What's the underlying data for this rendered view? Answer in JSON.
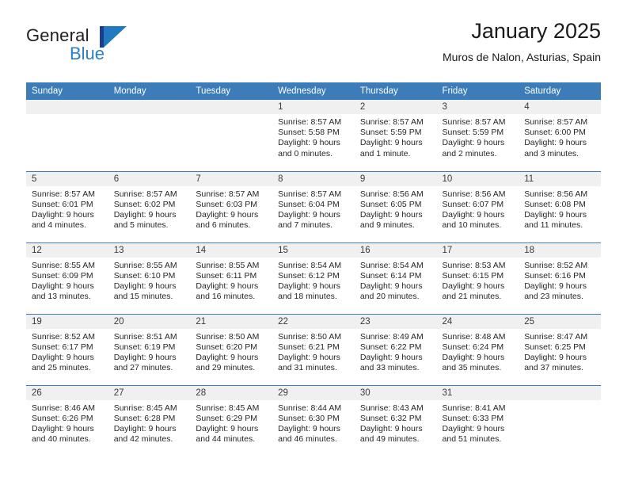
{
  "brand": {
    "name_part1": "General",
    "name_part2": "Blue",
    "logo_icon": "general-blue-triangle-logo"
  },
  "header": {
    "title": "January 2025",
    "subtitle": "Muros de Nalon, Asturias, Spain"
  },
  "colors": {
    "header_blue": "#3c7cb8",
    "brand_blue": "#2a7fc9",
    "brand_navy": "#1b3f8b",
    "daynum_band": "#f0f0f0"
  },
  "calendar": {
    "weekday_headers": [
      "Sunday",
      "Monday",
      "Tuesday",
      "Wednesday",
      "Thursday",
      "Friday",
      "Saturday"
    ],
    "weeks": [
      [
        {
          "day": "",
          "empty": true
        },
        {
          "day": "",
          "empty": true
        },
        {
          "day": "",
          "empty": true
        },
        {
          "day": "1",
          "sunrise": "Sunrise: 8:57 AM",
          "sunset": "Sunset: 5:58 PM",
          "daylight1": "Daylight: 9 hours",
          "daylight2": "and 0 minutes."
        },
        {
          "day": "2",
          "sunrise": "Sunrise: 8:57 AM",
          "sunset": "Sunset: 5:59 PM",
          "daylight1": "Daylight: 9 hours",
          "daylight2": "and 1 minute."
        },
        {
          "day": "3",
          "sunrise": "Sunrise: 8:57 AM",
          "sunset": "Sunset: 5:59 PM",
          "daylight1": "Daylight: 9 hours",
          "daylight2": "and 2 minutes."
        },
        {
          "day": "4",
          "sunrise": "Sunrise: 8:57 AM",
          "sunset": "Sunset: 6:00 PM",
          "daylight1": "Daylight: 9 hours",
          "daylight2": "and 3 minutes."
        }
      ],
      [
        {
          "day": "5",
          "sunrise": "Sunrise: 8:57 AM",
          "sunset": "Sunset: 6:01 PM",
          "daylight1": "Daylight: 9 hours",
          "daylight2": "and 4 minutes."
        },
        {
          "day": "6",
          "sunrise": "Sunrise: 8:57 AM",
          "sunset": "Sunset: 6:02 PM",
          "daylight1": "Daylight: 9 hours",
          "daylight2": "and 5 minutes."
        },
        {
          "day": "7",
          "sunrise": "Sunrise: 8:57 AM",
          "sunset": "Sunset: 6:03 PM",
          "daylight1": "Daylight: 9 hours",
          "daylight2": "and 6 minutes."
        },
        {
          "day": "8",
          "sunrise": "Sunrise: 8:57 AM",
          "sunset": "Sunset: 6:04 PM",
          "daylight1": "Daylight: 9 hours",
          "daylight2": "and 7 minutes."
        },
        {
          "day": "9",
          "sunrise": "Sunrise: 8:56 AM",
          "sunset": "Sunset: 6:05 PM",
          "daylight1": "Daylight: 9 hours",
          "daylight2": "and 9 minutes."
        },
        {
          "day": "10",
          "sunrise": "Sunrise: 8:56 AM",
          "sunset": "Sunset: 6:07 PM",
          "daylight1": "Daylight: 9 hours",
          "daylight2": "and 10 minutes."
        },
        {
          "day": "11",
          "sunrise": "Sunrise: 8:56 AM",
          "sunset": "Sunset: 6:08 PM",
          "daylight1": "Daylight: 9 hours",
          "daylight2": "and 11 minutes."
        }
      ],
      [
        {
          "day": "12",
          "sunrise": "Sunrise: 8:55 AM",
          "sunset": "Sunset: 6:09 PM",
          "daylight1": "Daylight: 9 hours",
          "daylight2": "and 13 minutes."
        },
        {
          "day": "13",
          "sunrise": "Sunrise: 8:55 AM",
          "sunset": "Sunset: 6:10 PM",
          "daylight1": "Daylight: 9 hours",
          "daylight2": "and 15 minutes."
        },
        {
          "day": "14",
          "sunrise": "Sunrise: 8:55 AM",
          "sunset": "Sunset: 6:11 PM",
          "daylight1": "Daylight: 9 hours",
          "daylight2": "and 16 minutes."
        },
        {
          "day": "15",
          "sunrise": "Sunrise: 8:54 AM",
          "sunset": "Sunset: 6:12 PM",
          "daylight1": "Daylight: 9 hours",
          "daylight2": "and 18 minutes."
        },
        {
          "day": "16",
          "sunrise": "Sunrise: 8:54 AM",
          "sunset": "Sunset: 6:14 PM",
          "daylight1": "Daylight: 9 hours",
          "daylight2": "and 20 minutes."
        },
        {
          "day": "17",
          "sunrise": "Sunrise: 8:53 AM",
          "sunset": "Sunset: 6:15 PM",
          "daylight1": "Daylight: 9 hours",
          "daylight2": "and 21 minutes."
        },
        {
          "day": "18",
          "sunrise": "Sunrise: 8:52 AM",
          "sunset": "Sunset: 6:16 PM",
          "daylight1": "Daylight: 9 hours",
          "daylight2": "and 23 minutes."
        }
      ],
      [
        {
          "day": "19",
          "sunrise": "Sunrise: 8:52 AM",
          "sunset": "Sunset: 6:17 PM",
          "daylight1": "Daylight: 9 hours",
          "daylight2": "and 25 minutes."
        },
        {
          "day": "20",
          "sunrise": "Sunrise: 8:51 AM",
          "sunset": "Sunset: 6:19 PM",
          "daylight1": "Daylight: 9 hours",
          "daylight2": "and 27 minutes."
        },
        {
          "day": "21",
          "sunrise": "Sunrise: 8:50 AM",
          "sunset": "Sunset: 6:20 PM",
          "daylight1": "Daylight: 9 hours",
          "daylight2": "and 29 minutes."
        },
        {
          "day": "22",
          "sunrise": "Sunrise: 8:50 AM",
          "sunset": "Sunset: 6:21 PM",
          "daylight1": "Daylight: 9 hours",
          "daylight2": "and 31 minutes."
        },
        {
          "day": "23",
          "sunrise": "Sunrise: 8:49 AM",
          "sunset": "Sunset: 6:22 PM",
          "daylight1": "Daylight: 9 hours",
          "daylight2": "and 33 minutes."
        },
        {
          "day": "24",
          "sunrise": "Sunrise: 8:48 AM",
          "sunset": "Sunset: 6:24 PM",
          "daylight1": "Daylight: 9 hours",
          "daylight2": "and 35 minutes."
        },
        {
          "day": "25",
          "sunrise": "Sunrise: 8:47 AM",
          "sunset": "Sunset: 6:25 PM",
          "daylight1": "Daylight: 9 hours",
          "daylight2": "and 37 minutes."
        }
      ],
      [
        {
          "day": "26",
          "sunrise": "Sunrise: 8:46 AM",
          "sunset": "Sunset: 6:26 PM",
          "daylight1": "Daylight: 9 hours",
          "daylight2": "and 40 minutes."
        },
        {
          "day": "27",
          "sunrise": "Sunrise: 8:45 AM",
          "sunset": "Sunset: 6:28 PM",
          "daylight1": "Daylight: 9 hours",
          "daylight2": "and 42 minutes."
        },
        {
          "day": "28",
          "sunrise": "Sunrise: 8:45 AM",
          "sunset": "Sunset: 6:29 PM",
          "daylight1": "Daylight: 9 hours",
          "daylight2": "and 44 minutes."
        },
        {
          "day": "29",
          "sunrise": "Sunrise: 8:44 AM",
          "sunset": "Sunset: 6:30 PM",
          "daylight1": "Daylight: 9 hours",
          "daylight2": "and 46 minutes."
        },
        {
          "day": "30",
          "sunrise": "Sunrise: 8:43 AM",
          "sunset": "Sunset: 6:32 PM",
          "daylight1": "Daylight: 9 hours",
          "daylight2": "and 49 minutes."
        },
        {
          "day": "31",
          "sunrise": "Sunrise: 8:41 AM",
          "sunset": "Sunset: 6:33 PM",
          "daylight1": "Daylight: 9 hours",
          "daylight2": "and 51 minutes."
        },
        {
          "day": "",
          "empty": true
        }
      ]
    ]
  }
}
